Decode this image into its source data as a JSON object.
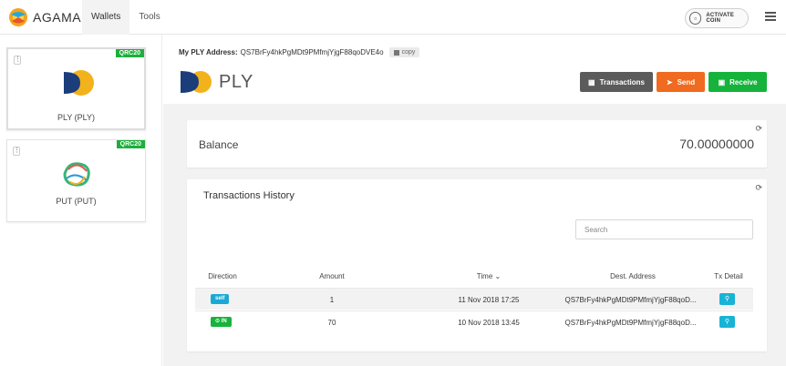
{
  "app": {
    "name": "AGAMA"
  },
  "nav": {
    "wallets": "Wallets",
    "tools": "Tools"
  },
  "activate": {
    "label": "ACTIVATE COIN"
  },
  "sidebar": {
    "coins": [
      {
        "name": "PLY (PLY)",
        "badge": "QRC20",
        "icon": "ply-coin-icon"
      },
      {
        "name": "PUT (PUT)",
        "badge": "QRC20",
        "icon": "put-coin-icon"
      }
    ]
  },
  "wallet": {
    "address_label": "My PLY Address:",
    "address": "QS7BrFy4hkPgMDt9PMfmjYjgF88qoDVE4o",
    "copy_label": "copy",
    "ticker": "PLY"
  },
  "actions": {
    "transactions": "Transactions",
    "send": "Send",
    "receive": "Receive"
  },
  "balance": {
    "label": "Balance",
    "value": "70.00000000"
  },
  "history": {
    "title": "Transactions History",
    "search_placeholder": "Search",
    "columns": {
      "direction": "Direction",
      "amount": "Amount",
      "time": "Time ⌄",
      "dest": "Dest. Address",
      "detail": "Tx Detail"
    },
    "rows": [
      {
        "direction": "self",
        "amount": "1",
        "time": "11 Nov 2018 17:25",
        "dest": "QS7BrFy4hkPgMDt9PMfmjYjgF88qoD..."
      },
      {
        "direction": "⊙ IN",
        "amount": "70",
        "time": "10 Nov 2018 13:45",
        "dest": "QS7BrFy4hkPgMDt9PMfmjYjgF88qoD..."
      }
    ]
  },
  "colors": {
    "send": "#f06a1f",
    "receive": "#16b33c",
    "transactions": "#5b5b5b",
    "badge": "#1caf3c",
    "detail": "#18b3d6"
  }
}
